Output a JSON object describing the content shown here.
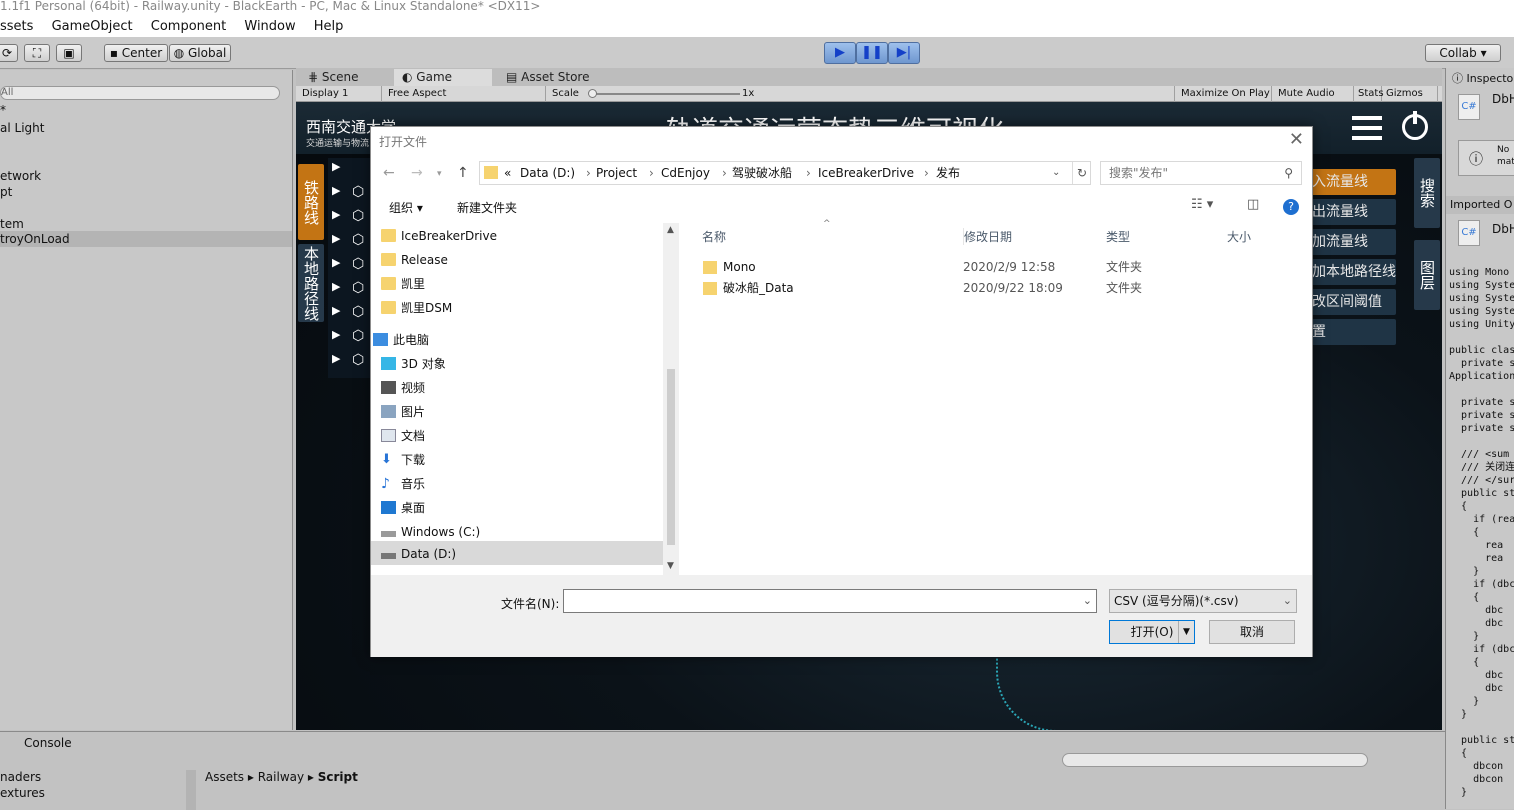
{
  "window": {
    "title": "1.1f1 Personal (64bit) - Railway.unity - BlackEarth - PC, Mac & Linux Standalone* <DX11>"
  },
  "menu": [
    "ssets",
    "GameObject",
    "Component",
    "Window",
    "Help"
  ],
  "toolbar": {
    "center": "Center",
    "global": "Global",
    "collab": "Collab ▾"
  },
  "hierarchy": {
    "search": "All",
    "rows": [
      "*",
      "al Light",
      "etwork",
      "pt",
      "tem",
      "troyOnLoad"
    ]
  },
  "game": {
    "tabs": {
      "scene": "Scene",
      "game": "Game",
      "asset_store": "Asset Store"
    },
    "display": "Display 1",
    "aspect": "Free Aspect",
    "scale_label": "Scale",
    "scale_value": "1x",
    "maximize": "Maximize On Play",
    "mute": "Mute Audio",
    "stats": "Stats",
    "gizmos": "Gizmos",
    "logo_title": "西南交通大学",
    "logo_sub": "交通运输与物流",
    "banner": "轨道交通运营态势三维可视化",
    "left_tabs": [
      "铁路线",
      "本地路径线"
    ],
    "right_buttons": [
      "入流量线",
      "出流量线",
      "加流量线",
      "加本地路径线",
      "改区间阈值",
      "置"
    ],
    "right_tabs": [
      "搜索",
      "图层"
    ]
  },
  "inspector": {
    "tab": "Inspecto",
    "name": "DbH",
    "no_label": "No",
    "mat_label": "mat",
    "imported": "Imported O",
    "name2": "DbH",
    "code": [
      "using Mono",
      "using Syste",
      "using Syste",
      "using Syste",
      "using UnityE",
      "",
      "public class",
      "  private s",
      "Application.",
      "",
      "  private s",
      "  private s",
      "  private s",
      "",
      "  /// <sum",
      "  /// 关闭连",
      "  /// </sur",
      "  public sta",
      "  {",
      "    if (rea",
      "    {",
      "      rea",
      "      rea",
      "    }",
      "    if (dbc",
      "    {",
      "      dbc",
      "      dbc",
      "    }",
      "    if (dbc",
      "    {",
      "      dbc",
      "      dbc",
      "    }",
      "  }",
      "",
      "  public sta",
      "  {",
      "    dbcon",
      "    dbcon",
      "  }"
    ]
  },
  "bottom": {
    "console": "Console",
    "left_items": [
      "naders",
      "extures"
    ],
    "breadcrumb": [
      "Assets",
      "Railway",
      "Script"
    ]
  },
  "dialog": {
    "title": "打开文件",
    "path": [
      "«",
      "Data (D:)",
      "Project",
      "CdEnjoy",
      "驾驶破冰船",
      "IceBreakerDrive",
      "发布"
    ],
    "search_placeholder": "搜索\"发布\"",
    "organize": "组织 ▾",
    "new_folder": "新建文件夹",
    "tree": [
      "IceBreakerDrive",
      "Release",
      "凯里",
      "凯里DSM",
      "此电脑",
      "3D 对象",
      "视频",
      "图片",
      "文档",
      "下载",
      "音乐",
      "桌面",
      "Windows (C:)",
      "Data (D:)"
    ],
    "columns": {
      "name": "名称",
      "modified": "修改日期",
      "type": "类型",
      "size": "大小"
    },
    "files": [
      {
        "name": "Mono",
        "modified": "2020/2/9 12:58",
        "type": "文件夹"
      },
      {
        "name": "破冰船_Data",
        "modified": "2020/9/22 18:09",
        "type": "文件夹"
      }
    ],
    "filename_label": "文件名(N):",
    "filename_value": "",
    "filetype": "CSV (逗号分隔)(*.csv)",
    "open": "打开(O)",
    "cancel": "取消"
  }
}
